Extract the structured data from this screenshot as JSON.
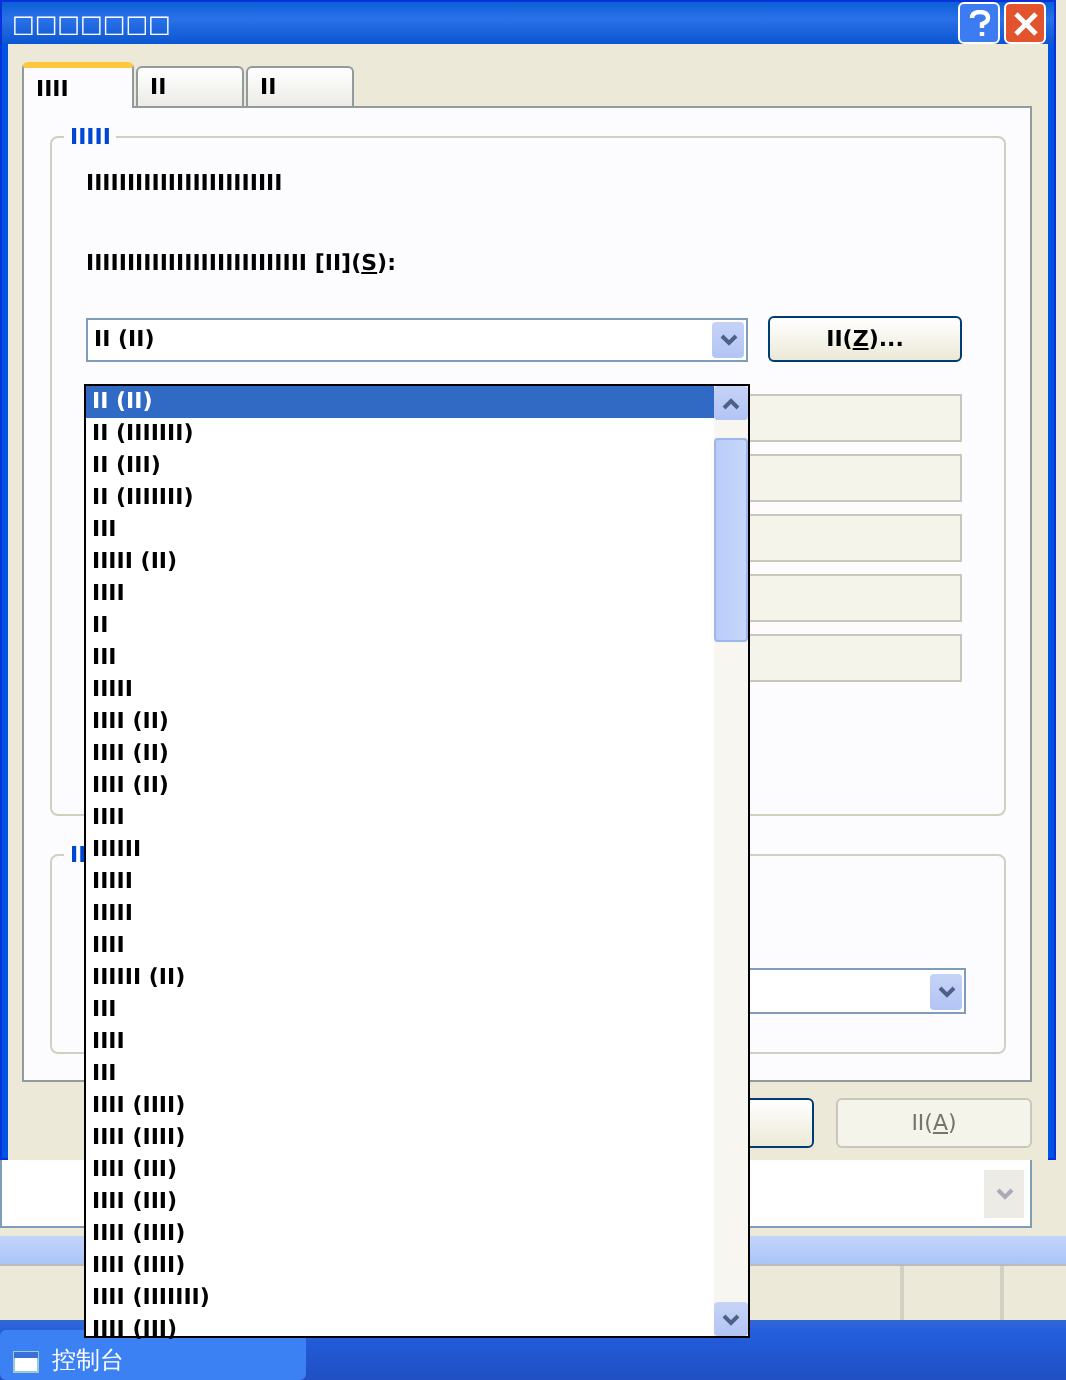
{
  "window": {
    "title": "□□□□□□□"
  },
  "tabs": [
    {
      "label": "IIII",
      "selected": true
    },
    {
      "label": "II",
      "selected": false
    },
    {
      "label": "II",
      "selected": false
    }
  ],
  "group_1": {
    "title": "IIIII",
    "description": "IIIIIIIIIIIIIIIIIIIIIIII",
    "prompt": {
      "before": "IIIIIIIIIIIIIIIIIIIIIIIIIII [II](",
      "key": "S",
      "after": "):"
    },
    "combo": {
      "value": "II (II)"
    },
    "button": {
      "before": "II(",
      "key": "Z",
      "after": ")..."
    },
    "options": [
      {
        "label": "II (II)",
        "selected": true
      },
      {
        "label": "II (IIIIIII)",
        "selected": false
      },
      {
        "label": "II (III)",
        "selected": false
      },
      {
        "label": "II (IIIIIII)",
        "selected": false
      },
      {
        "label": "III",
        "selected": false
      },
      {
        "label": "IIIII (II)",
        "selected": false
      },
      {
        "label": "IIII",
        "selected": false
      },
      {
        "label": "II",
        "selected": false
      },
      {
        "label": "III",
        "selected": false
      },
      {
        "label": "IIIII",
        "selected": false
      },
      {
        "label": "IIII (II)",
        "selected": false
      },
      {
        "label": "IIII (II)",
        "selected": false
      },
      {
        "label": "IIII (II)",
        "selected": false
      },
      {
        "label": "IIII",
        "selected": false
      },
      {
        "label": "IIIIII",
        "selected": false
      },
      {
        "label": "IIIII",
        "selected": false
      },
      {
        "label": "IIIII",
        "selected": false
      },
      {
        "label": "IIII",
        "selected": false
      },
      {
        "label": "IIIIII (II)",
        "selected": false
      },
      {
        "label": "III",
        "selected": false
      },
      {
        "label": "IIII",
        "selected": false
      },
      {
        "label": "III",
        "selected": false
      },
      {
        "label": "IIII (IIII)",
        "selected": false
      },
      {
        "label": "IIII (IIII)",
        "selected": false
      },
      {
        "label": "IIII (III)",
        "selected": false
      },
      {
        "label": "IIII (III)",
        "selected": false
      },
      {
        "label": "IIII (IIII)",
        "selected": false
      },
      {
        "label": "IIII (IIII)",
        "selected": false
      },
      {
        "label": "IIII (IIIIIII)",
        "selected": false
      },
      {
        "label": "IIII (III)",
        "selected": false
      }
    ]
  },
  "group_2": {
    "title": "II"
  },
  "buttons": [
    {
      "disabled": false
    },
    {
      "before": "II(",
      "key": "A",
      "after": ")",
      "disabled": true
    }
  ],
  "taskbar": {
    "items": [
      {
        "label": "控制台",
        "selected": false
      }
    ]
  }
}
